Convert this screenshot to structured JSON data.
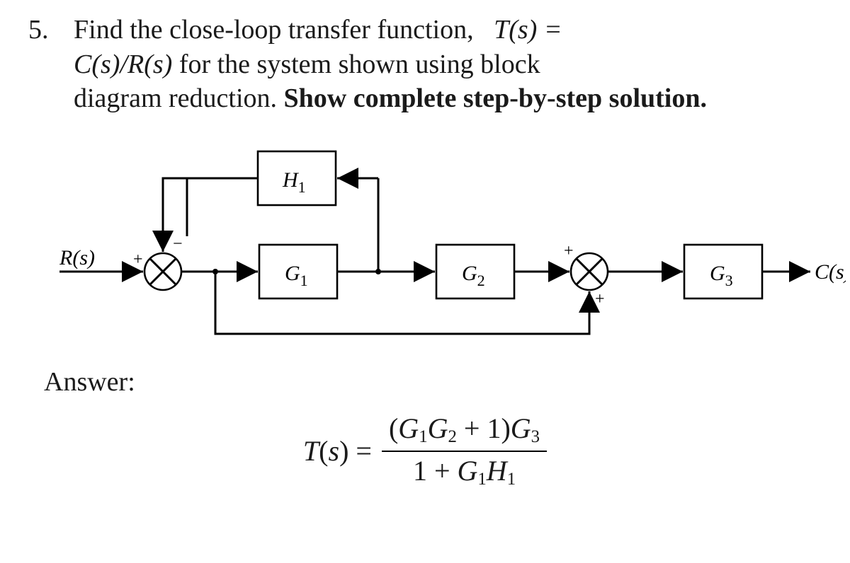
{
  "question": {
    "number": "5.",
    "text_plain": "Find the close-loop transfer function,",
    "ts_lhs": "T(s) =",
    "line2a": "C(s)/R(s)",
    "line2b": " for the system shown using block",
    "line3": "diagram reduction. ",
    "bold": "Show complete step-by-step solution."
  },
  "labels": {
    "R": "R(s)",
    "C": "C(s)",
    "H1": "H",
    "H1sub": "1",
    "G1": "G",
    "G1sub": "1",
    "G2": "G",
    "G2sub": "2",
    "G3": "G",
    "G3sub": "3",
    "plus": "+",
    "minus": "−"
  },
  "answer_label": "Answer:",
  "formula": {
    "lhs": "T(s) =",
    "num": "(G₁G₂ + 1)G₃",
    "den": "1 + G₁H₁"
  }
}
